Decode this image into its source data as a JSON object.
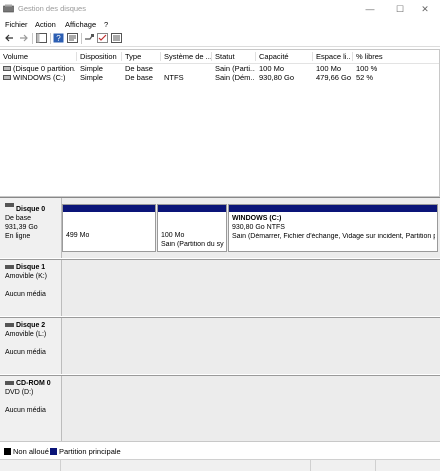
{
  "window": {
    "title": "Gestion des disques",
    "minimize": "—",
    "maximize": "☐",
    "close": "✕"
  },
  "menu": [
    "Fichier",
    "Action",
    "Affichage",
    "?"
  ],
  "columns": [
    "Volume",
    "Disposition",
    "Type",
    "Système de ...",
    "Statut",
    "Capacité",
    "Espace li...",
    "% libres"
  ],
  "volumes": [
    [
      "(Disque 0 partition...",
      "Simple",
      "De base",
      "",
      "Sain (Parti...",
      "100 Mo",
      "100 Mo",
      "100 %"
    ],
    [
      "WINDOWS (C:)",
      "Simple",
      "De base",
      "NTFS",
      "Sain (Dém...",
      "930,80 Go",
      "479,66 Go",
      "52 %"
    ]
  ],
  "disks": [
    {
      "name": "Disque 0",
      "line1": "De base",
      "line2": "931,39 Go",
      "line3": "En ligne",
      "partitions": [
        {
          "title": "",
          "line1": "499 Mo",
          "line2": ""
        },
        {
          "title": "",
          "line1": "100 Mo",
          "line2": "Sain (Partition du sy"
        },
        {
          "title": "WINDOWS  (C:)",
          "line1": "930,80 Go NTFS",
          "line2": "Sain (Démarrer, Fichier d'échange, Vidage sur incident, Partition p"
        }
      ]
    },
    {
      "name": "Disque 1",
      "line1": "Amovible (K:)",
      "line2": "",
      "line3": "Aucun média"
    },
    {
      "name": "Disque 2",
      "line1": "Amovible (L:)",
      "line2": "",
      "line3": "Aucun média"
    },
    {
      "name": "CD-ROM 0",
      "line1": "DVD (D:)",
      "line2": "",
      "line3": "Aucun média"
    }
  ],
  "legend": [
    {
      "label": "Non alloué",
      "color": "#000000"
    },
    {
      "label": "Partition principale",
      "color": "#0a1478"
    }
  ]
}
